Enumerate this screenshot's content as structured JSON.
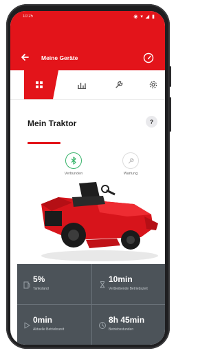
{
  "statusbar": {
    "time": "10:25",
    "icons": "◉ ▾ ◢ ▮"
  },
  "appbar": {
    "title": "Meine Geräte"
  },
  "device": {
    "name": "Mein Traktor",
    "help": "?"
  },
  "status_items": [
    {
      "label": "Verbunden",
      "icon": "bluetooth-icon"
    },
    {
      "label": "Wartung",
      "icon": "wrench-icon"
    }
  ],
  "stats": [
    {
      "value": "5%",
      "label": "Tankstand",
      "icon": "fuel-icon"
    },
    {
      "value": "10min",
      "label": "Verbleibende Betriebszeit",
      "icon": "hourglass-icon"
    },
    {
      "value": "0min",
      "label": "Aktuelle Betriebszeit",
      "icon": "play-icon"
    },
    {
      "value": "8h 45min",
      "label": "Betriebsstunden",
      "icon": "clock-icon"
    }
  ],
  "colors": {
    "brand_red": "#e3141a",
    "stats_bg": "#4c5359",
    "bluetooth_green": "#39b46b"
  }
}
